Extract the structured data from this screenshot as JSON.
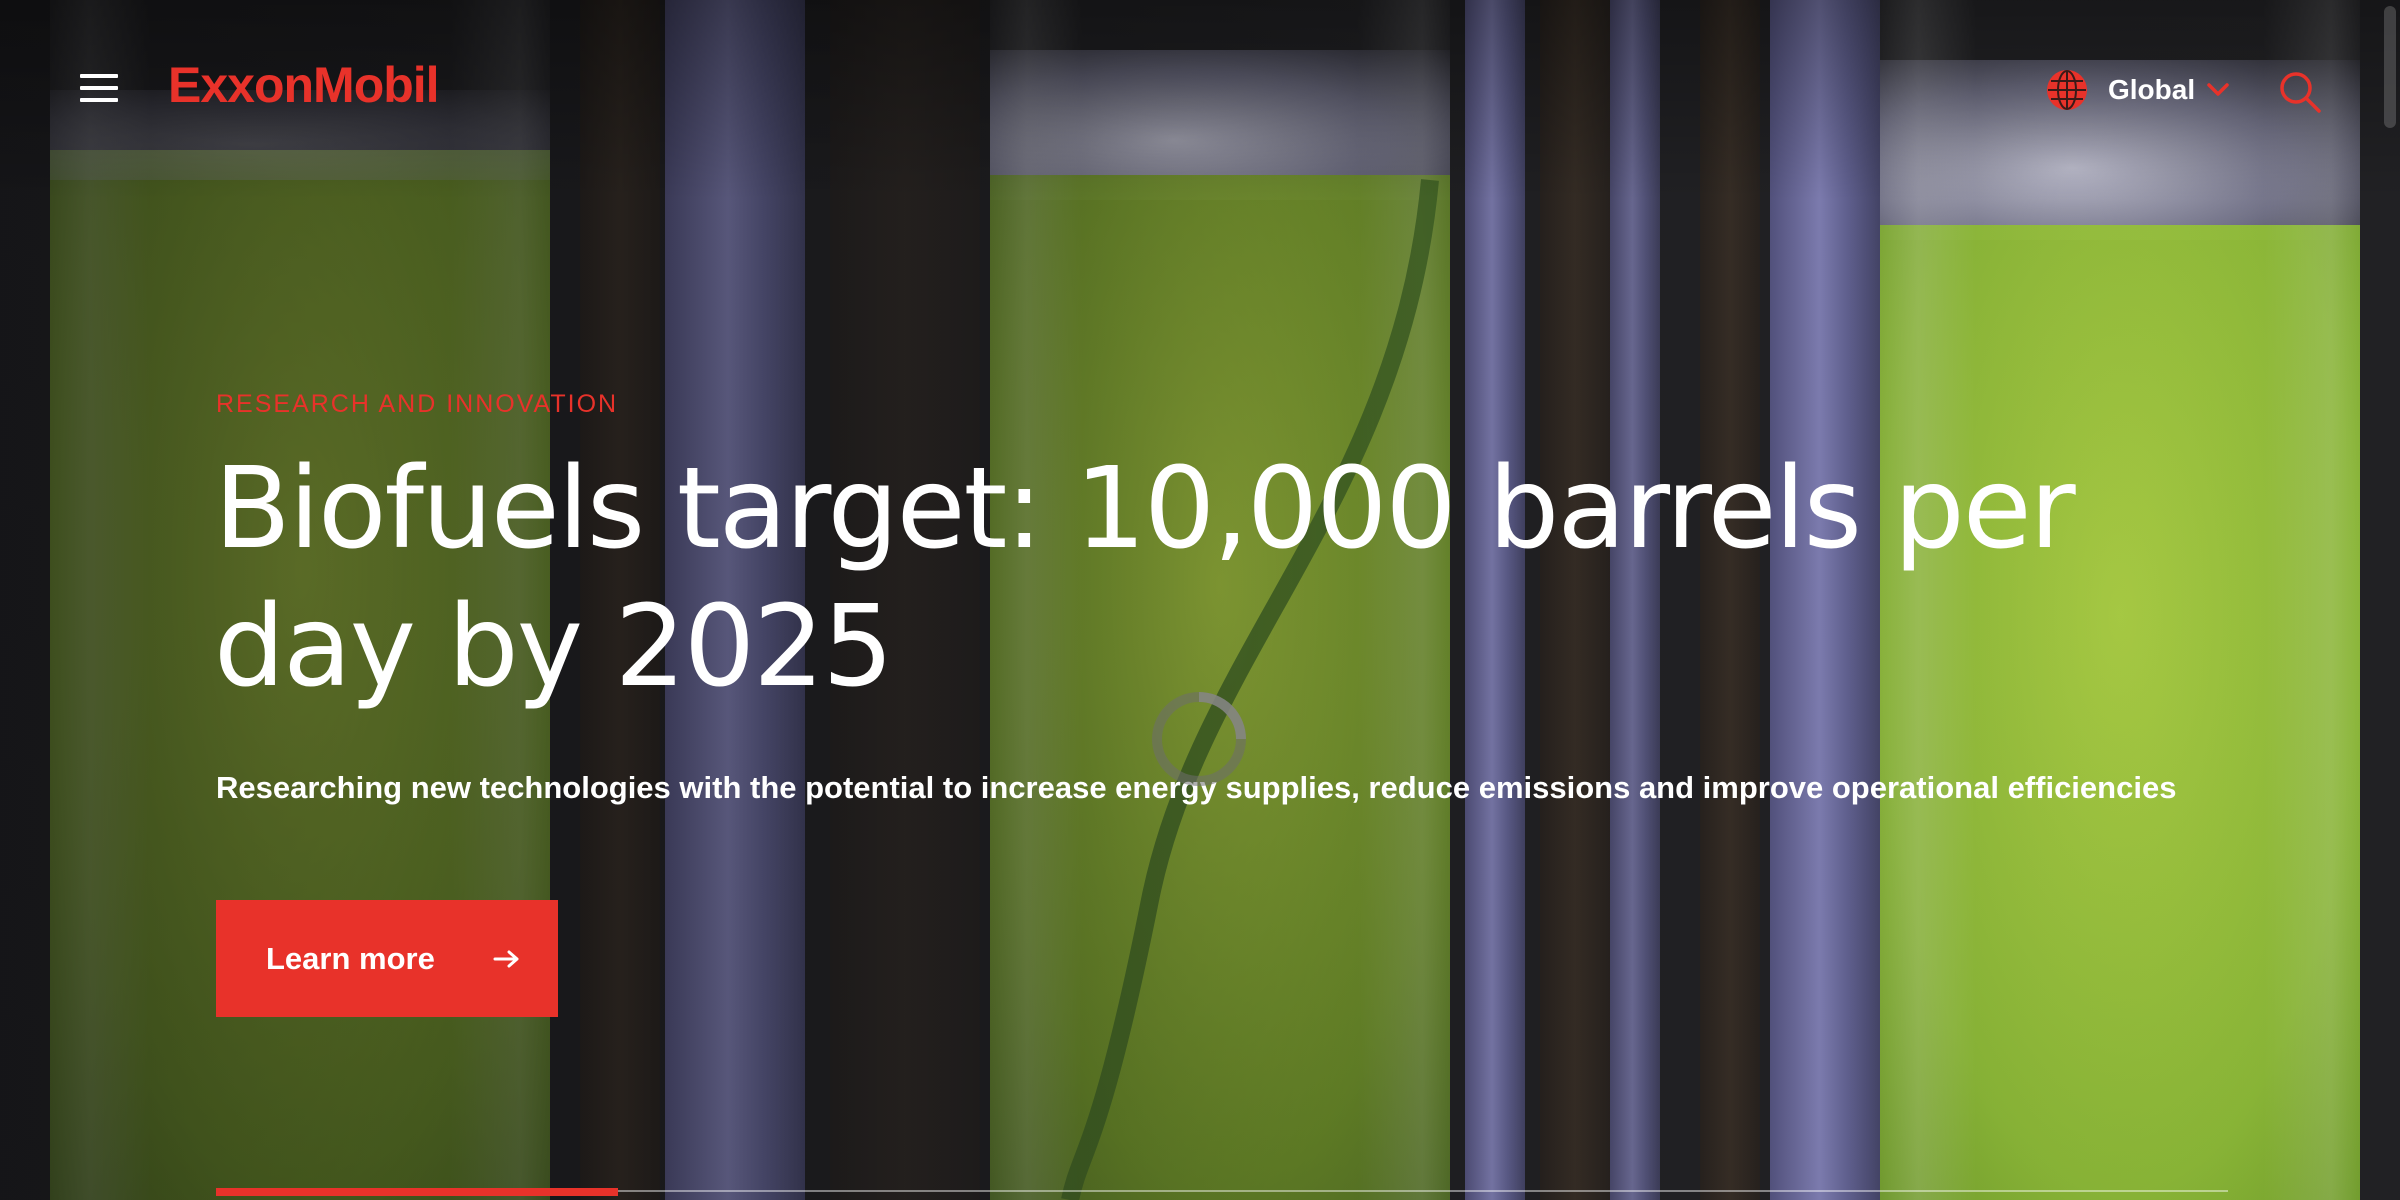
{
  "header": {
    "logo_text": "ExxonMobil",
    "region_label": "Global",
    "icons": {
      "menu": "hamburger-menu-icon",
      "globe": "globe-icon",
      "chevron": "chevron-down-icon",
      "search": "search-icon"
    }
  },
  "hero": {
    "eyebrow": "RESEARCH AND INNOVATION",
    "headline": "Biofuels target: 10,000 barrels per day by 2025",
    "subhead": "Researching new technologies with the potential to increase energy supplies, reduce emissions and improve operational efficiencies",
    "cta_label": "Learn more",
    "cta_icon": "arrow-right-icon"
  },
  "slider": {
    "progress": 0.2
  },
  "colors": {
    "brand_red": "#e8322a",
    "text_white": "#ffffff"
  }
}
